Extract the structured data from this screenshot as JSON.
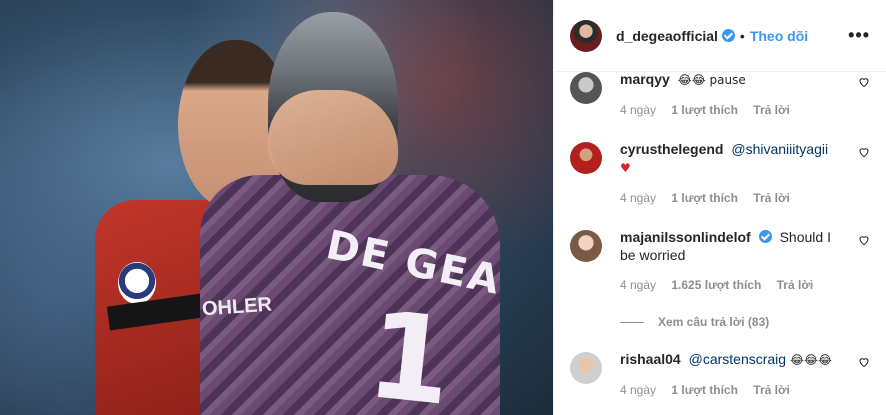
{
  "post": {
    "player_name": "DE GEA",
    "player_number": "1",
    "sponsor": "OHLER"
  },
  "header": {
    "username": "d_degeaofficial",
    "separator": "•",
    "follow_label": "Theo dõi",
    "more_label": "•••"
  },
  "comments": [
    {
      "username": "marqyy",
      "text": "😂😂 pause",
      "time": "4 ngày",
      "likes": "1 lượt thích",
      "reply": "Trả lời"
    },
    {
      "username": "cyrusthelegend",
      "mention": "@shivaniiityagii",
      "emoji": "♥",
      "time": "4 ngày",
      "likes": "1 lượt thích",
      "reply": "Trả lời"
    },
    {
      "username": "majanilssonlindelof",
      "text": "Should I be worried",
      "time": "4 ngày",
      "likes": "1.625 lượt thích",
      "reply": "Trả lời",
      "view_replies": "Xem câu trả lời (83)"
    },
    {
      "username": "rishaal04",
      "mention": "@carstenscraig",
      "emoji": "😂😂😂",
      "time": "4 ngày",
      "likes": "1 lượt thích",
      "reply": "Trả lời"
    }
  ]
}
